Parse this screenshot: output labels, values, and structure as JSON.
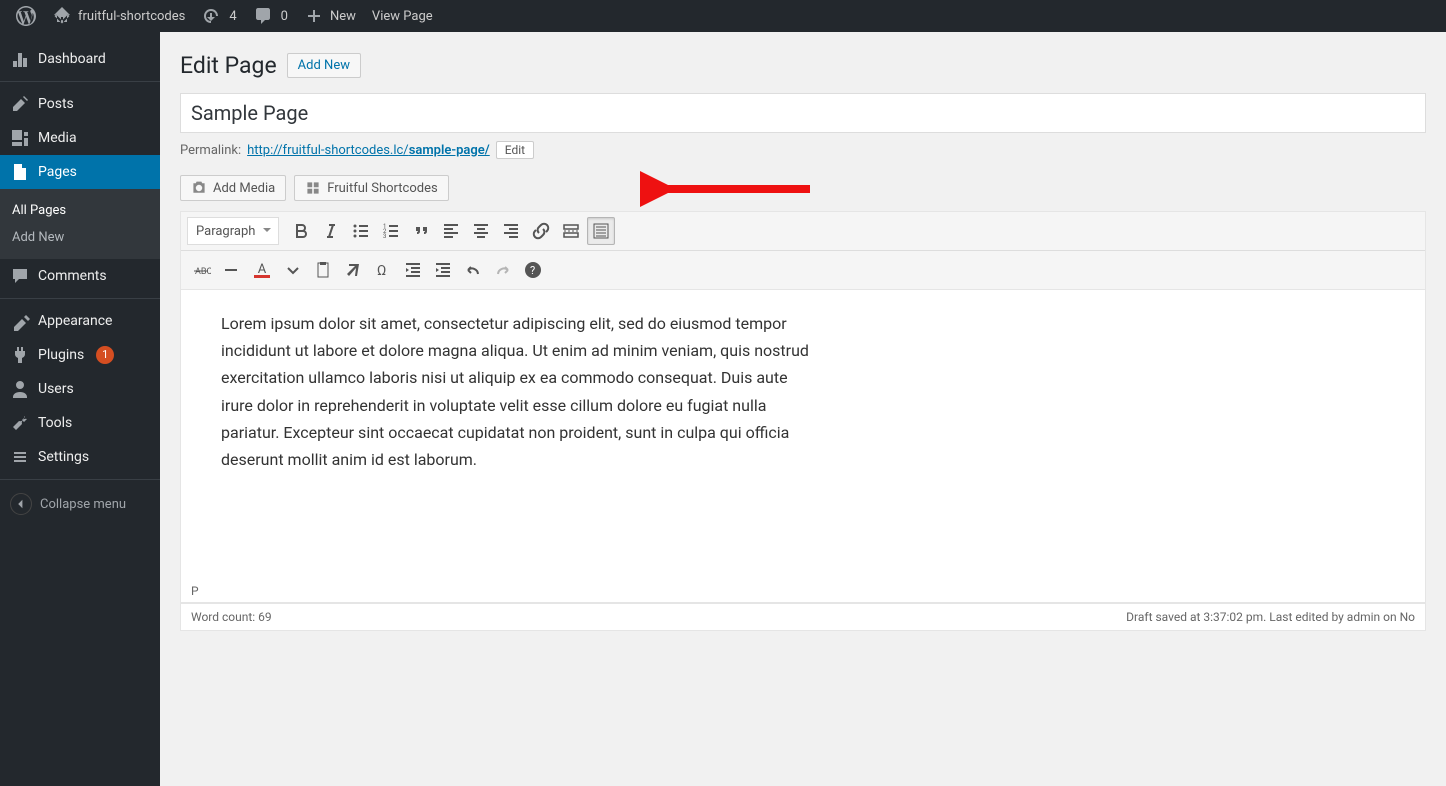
{
  "adminbar": {
    "site_name": "fruitful-shortcodes",
    "updates_count": "4",
    "comments_count": "0",
    "new_label": "New",
    "view_page": "View Page"
  },
  "sidebar": {
    "dashboard": "Dashboard",
    "posts": "Posts",
    "media": "Media",
    "pages": "Pages",
    "all_pages": "All Pages",
    "add_new": "Add New",
    "comments": "Comments",
    "appearance": "Appearance",
    "plugins": "Plugins",
    "plugins_badge": "1",
    "users": "Users",
    "tools": "Tools",
    "settings": "Settings",
    "collapse": "Collapse menu"
  },
  "page": {
    "heading": "Edit Page",
    "add_new": "Add New",
    "title_value": "Sample Page",
    "permalink_label": "Permalink:",
    "permalink_base": "http://fruitful-shortcodes.lc/",
    "permalink_slug": "sample-page/",
    "edit_slug": "Edit",
    "add_media": "Add Media",
    "fruitful_shortcodes": "Fruitful Shortcodes",
    "format_selector": "Paragraph",
    "content": "Lorem ipsum dolor sit amet, consectetur adipiscing elit, sed do eiusmod tempor incididunt ut labore et dolore magna aliqua. Ut enim ad minim veniam, quis nostrud exercitation ullamco laboris nisi ut aliquip ex ea commodo consequat. Duis aute irure dolor in reprehenderit in voluptate velit esse cillum dolore eu fugiat nulla pariatur. Excepteur sint occaecat cupidatat non proident, sunt in culpa qui officia deserunt mollit anim id est laborum.",
    "path": "P",
    "word_count": "Word count: 69",
    "draft_status": "Draft saved at 3:37:02 pm. Last edited by admin on No"
  }
}
